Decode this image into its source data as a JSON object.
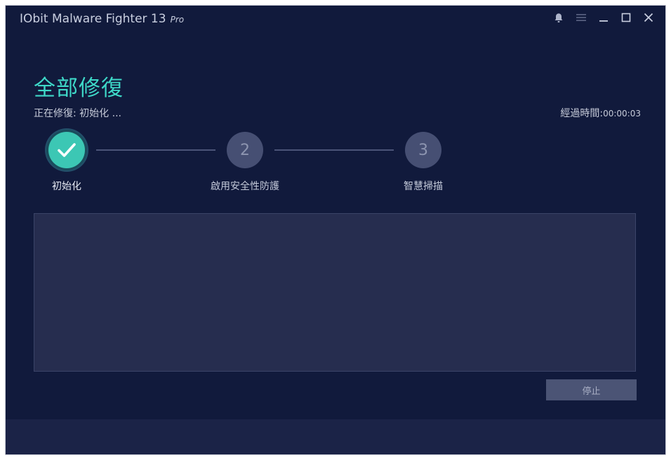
{
  "app": {
    "title": "IObit Malware Fighter 13",
    "edition": "Pro"
  },
  "window_controls": {
    "icons": [
      "bell-icon",
      "menu-icon",
      "minimize-icon",
      "maximize-icon",
      "close-icon"
    ]
  },
  "main": {
    "heading": "全部修復",
    "status_text": "正在修復: 初始化 ...",
    "elapsed_label": "經過時間:",
    "elapsed_time": "00:00:03"
  },
  "steps": [
    {
      "number": "",
      "label": "初始化",
      "state": "done"
    },
    {
      "number": "2",
      "label": "啟用安全性防護",
      "state": "pending"
    },
    {
      "number": "3",
      "label": "智慧掃描",
      "state": "pending"
    }
  ],
  "actions": {
    "stop_label": "停止"
  },
  "colors": {
    "background": "#111a3c",
    "accent": "#3ed8c8",
    "step_done": "#3cc7b4",
    "step_pending": "#464f73",
    "panel": "#262d4f",
    "footer": "#1b2347"
  }
}
